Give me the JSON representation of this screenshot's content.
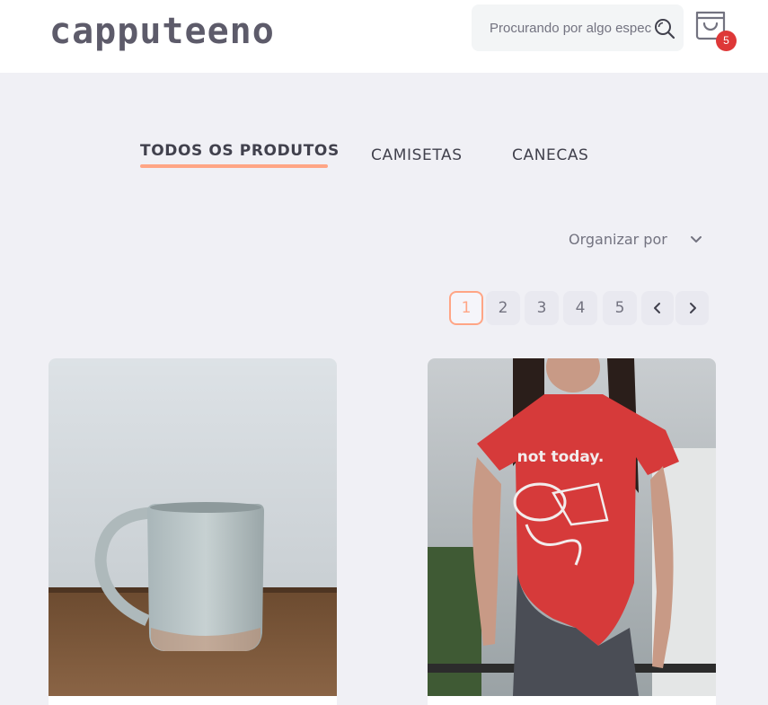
{
  "header": {
    "logo": "capputeeno",
    "search_placeholder": "Procurando por algo específico?",
    "cart_count": "5"
  },
  "tabs": [
    {
      "label": "TODOS OS PRODUTOS",
      "active": true
    },
    {
      "label": "CAMISETAS",
      "active": false
    },
    {
      "label": "CANECAS",
      "active": false
    }
  ],
  "sort": {
    "label": "Organizar por"
  },
  "pagination": {
    "pages": [
      "1",
      "2",
      "3",
      "4",
      "5"
    ],
    "current": "1",
    "prev_icon": "chevron-left-icon",
    "next_icon": "chevron-right-icon"
  },
  "products": [
    {
      "image": "ceramic mug on wooden table"
    },
    {
      "image": "woman wearing red \"not today.\" t-shirt",
      "shirt_text": "not today."
    }
  ],
  "colors": {
    "accent": "#ffa585",
    "badge": "#de3838",
    "logo": "#5d5b6a",
    "background": "#f0f0f5"
  }
}
